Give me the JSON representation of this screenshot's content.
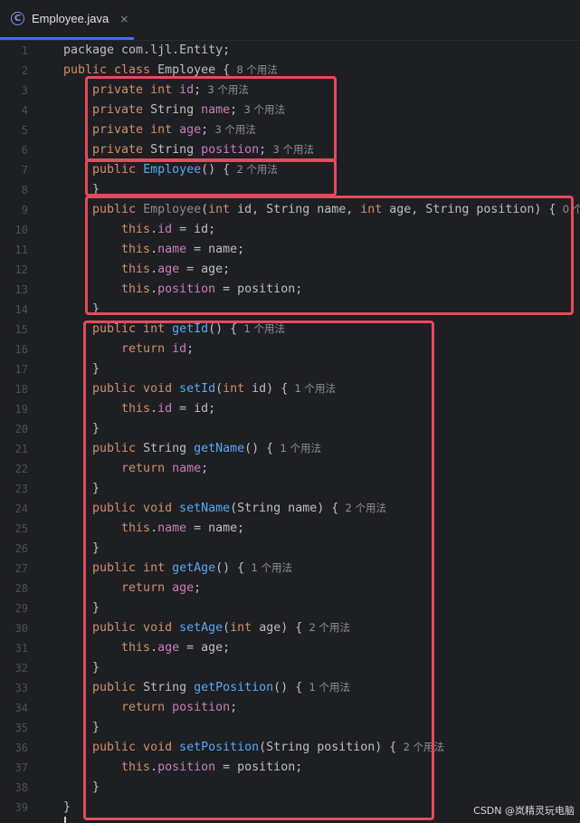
{
  "tab": {
    "icon": "class-icon",
    "icon_glyph": "C",
    "title": "Employee.java",
    "close_glyph": "×"
  },
  "lines": [
    {
      "n": "1",
      "tokens": [
        {
          "t": "package com.ljl.Entity;",
          "c": ""
        }
      ]
    },
    {
      "n": "2",
      "tokens": [
        {
          "t": "public class ",
          "c": "kw"
        },
        {
          "t": "Employee {",
          "c": ""
        },
        {
          "t": "  8 个用法",
          "c": "hint"
        }
      ]
    },
    {
      "n": "3",
      "tokens": [
        {
          "t": "    private int ",
          "c": "kw"
        },
        {
          "t": "id",
          "c": "fld"
        },
        {
          "t": ";",
          "c": ""
        },
        {
          "t": "  3 个用法",
          "c": "hint"
        }
      ]
    },
    {
      "n": "4",
      "tokens": [
        {
          "t": "    private ",
          "c": "kw"
        },
        {
          "t": "String ",
          "c": ""
        },
        {
          "t": "name",
          "c": "fld"
        },
        {
          "t": ";",
          "c": ""
        },
        {
          "t": "  3 个用法",
          "c": "hint"
        }
      ]
    },
    {
      "n": "5",
      "tokens": [
        {
          "t": "    private int ",
          "c": "kw"
        },
        {
          "t": "age",
          "c": "fld"
        },
        {
          "t": ";",
          "c": ""
        },
        {
          "t": "  3 个用法",
          "c": "hint"
        }
      ]
    },
    {
      "n": "6",
      "tokens": [
        {
          "t": "    private ",
          "c": "kw"
        },
        {
          "t": "String ",
          "c": ""
        },
        {
          "t": "position",
          "c": "fld"
        },
        {
          "t": ";",
          "c": ""
        },
        {
          "t": "  3 个用法",
          "c": "hint"
        }
      ]
    },
    {
      "n": "7",
      "tokens": [
        {
          "t": "    public ",
          "c": "kw"
        },
        {
          "t": "Employee",
          "c": "ctor"
        },
        {
          "t": "() {",
          "c": ""
        },
        {
          "t": "  2 个用法",
          "c": "hint"
        }
      ]
    },
    {
      "n": "8",
      "tokens": [
        {
          "t": "    }",
          "c": ""
        }
      ]
    },
    {
      "n": "9",
      "tokens": [
        {
          "t": "    public ",
          "c": "kw"
        },
        {
          "t": "Employee",
          "c": "ctor-unused"
        },
        {
          "t": "(",
          "c": ""
        },
        {
          "t": "int ",
          "c": "kw"
        },
        {
          "t": "id, String name, ",
          "c": ""
        },
        {
          "t": "int ",
          "c": "kw"
        },
        {
          "t": "age, String position) {",
          "c": ""
        },
        {
          "t": "  0 个",
          "c": "hint"
        }
      ]
    },
    {
      "n": "10",
      "tokens": [
        {
          "t": "        this",
          "c": "kw"
        },
        {
          "t": ".",
          "c": ""
        },
        {
          "t": "id",
          "c": "fld"
        },
        {
          "t": " = id;",
          "c": ""
        }
      ]
    },
    {
      "n": "11",
      "tokens": [
        {
          "t": "        this",
          "c": "kw"
        },
        {
          "t": ".",
          "c": ""
        },
        {
          "t": "name",
          "c": "fld"
        },
        {
          "t": " = name;",
          "c": ""
        }
      ]
    },
    {
      "n": "12",
      "tokens": [
        {
          "t": "        this",
          "c": "kw"
        },
        {
          "t": ".",
          "c": ""
        },
        {
          "t": "age",
          "c": "fld"
        },
        {
          "t": " = age;",
          "c": ""
        }
      ]
    },
    {
      "n": "13",
      "tokens": [
        {
          "t": "        this",
          "c": "kw"
        },
        {
          "t": ".",
          "c": ""
        },
        {
          "t": "position",
          "c": "fld"
        },
        {
          "t": " = position;",
          "c": ""
        }
      ]
    },
    {
      "n": "14",
      "tokens": [
        {
          "t": "    }",
          "c": ""
        }
      ]
    },
    {
      "n": "15",
      "tokens": [
        {
          "t": "    public int ",
          "c": "kw"
        },
        {
          "t": "getId",
          "c": "fn"
        },
        {
          "t": "() {",
          "c": ""
        },
        {
          "t": "  1 个用法",
          "c": "hint"
        }
      ]
    },
    {
      "n": "16",
      "tokens": [
        {
          "t": "        return ",
          "c": "kw"
        },
        {
          "t": "id",
          "c": "fld"
        },
        {
          "t": ";",
          "c": ""
        }
      ]
    },
    {
      "n": "17",
      "tokens": [
        {
          "t": "    }",
          "c": ""
        }
      ]
    },
    {
      "n": "18",
      "tokens": [
        {
          "t": "    public void ",
          "c": "kw"
        },
        {
          "t": "setId",
          "c": "fn"
        },
        {
          "t": "(",
          "c": ""
        },
        {
          "t": "int ",
          "c": "kw"
        },
        {
          "t": "id) {",
          "c": ""
        },
        {
          "t": "  1 个用法",
          "c": "hint"
        }
      ]
    },
    {
      "n": "19",
      "tokens": [
        {
          "t": "        this",
          "c": "kw"
        },
        {
          "t": ".",
          "c": ""
        },
        {
          "t": "id",
          "c": "fld"
        },
        {
          "t": " = id;",
          "c": ""
        }
      ]
    },
    {
      "n": "20",
      "tokens": [
        {
          "t": "    }",
          "c": ""
        }
      ]
    },
    {
      "n": "21",
      "tokens": [
        {
          "t": "    public ",
          "c": "kw"
        },
        {
          "t": "String ",
          "c": ""
        },
        {
          "t": "getName",
          "c": "fn"
        },
        {
          "t": "() {",
          "c": ""
        },
        {
          "t": "  1 个用法",
          "c": "hint"
        }
      ]
    },
    {
      "n": "22",
      "tokens": [
        {
          "t": "        return ",
          "c": "kw"
        },
        {
          "t": "name",
          "c": "fld"
        },
        {
          "t": ";",
          "c": ""
        }
      ]
    },
    {
      "n": "23",
      "tokens": [
        {
          "t": "    }",
          "c": ""
        }
      ]
    },
    {
      "n": "24",
      "tokens": [
        {
          "t": "    public void ",
          "c": "kw"
        },
        {
          "t": "setName",
          "c": "fn"
        },
        {
          "t": "(String name) {",
          "c": ""
        },
        {
          "t": "  2 个用法",
          "c": "hint"
        }
      ]
    },
    {
      "n": "25",
      "tokens": [
        {
          "t": "        this",
          "c": "kw"
        },
        {
          "t": ".",
          "c": ""
        },
        {
          "t": "name",
          "c": "fld"
        },
        {
          "t": " = name;",
          "c": ""
        }
      ]
    },
    {
      "n": "26",
      "tokens": [
        {
          "t": "    }",
          "c": ""
        }
      ]
    },
    {
      "n": "27",
      "tokens": [
        {
          "t": "    public int ",
          "c": "kw"
        },
        {
          "t": "getAge",
          "c": "fn"
        },
        {
          "t": "() {",
          "c": ""
        },
        {
          "t": "  1 个用法",
          "c": "hint"
        }
      ]
    },
    {
      "n": "28",
      "tokens": [
        {
          "t": "        return ",
          "c": "kw"
        },
        {
          "t": "age",
          "c": "fld"
        },
        {
          "t": ";",
          "c": ""
        }
      ]
    },
    {
      "n": "29",
      "tokens": [
        {
          "t": "    }",
          "c": ""
        }
      ]
    },
    {
      "n": "30",
      "tokens": [
        {
          "t": "    public void ",
          "c": "kw"
        },
        {
          "t": "setAge",
          "c": "fn"
        },
        {
          "t": "(",
          "c": ""
        },
        {
          "t": "int ",
          "c": "kw"
        },
        {
          "t": "age) {",
          "c": ""
        },
        {
          "t": "  2 个用法",
          "c": "hint"
        }
      ]
    },
    {
      "n": "31",
      "tokens": [
        {
          "t": "        this",
          "c": "kw"
        },
        {
          "t": ".",
          "c": ""
        },
        {
          "t": "age",
          "c": "fld"
        },
        {
          "t": " = age;",
          "c": ""
        }
      ]
    },
    {
      "n": "32",
      "tokens": [
        {
          "t": "    }",
          "c": ""
        }
      ]
    },
    {
      "n": "33",
      "tokens": [
        {
          "t": "    public ",
          "c": "kw"
        },
        {
          "t": "String ",
          "c": ""
        },
        {
          "t": "getPosition",
          "c": "fn"
        },
        {
          "t": "() {",
          "c": ""
        },
        {
          "t": "  1 个用法",
          "c": "hint"
        }
      ]
    },
    {
      "n": "34",
      "tokens": [
        {
          "t": "        return ",
          "c": "kw"
        },
        {
          "t": "position",
          "c": "fld"
        },
        {
          "t": ";",
          "c": ""
        }
      ]
    },
    {
      "n": "35",
      "tokens": [
        {
          "t": "    }",
          "c": ""
        }
      ]
    },
    {
      "n": "36",
      "tokens": [
        {
          "t": "    public void ",
          "c": "kw"
        },
        {
          "t": "setPosition",
          "c": "fn"
        },
        {
          "t": "(String position) {",
          "c": ""
        },
        {
          "t": "  2 个用法",
          "c": "hint"
        }
      ]
    },
    {
      "n": "37",
      "tokens": [
        {
          "t": "        this",
          "c": "kw"
        },
        {
          "t": ".",
          "c": ""
        },
        {
          "t": "position",
          "c": "fld"
        },
        {
          "t": " = position;",
          "c": ""
        }
      ]
    },
    {
      "n": "38",
      "tokens": [
        {
          "t": "    }",
          "c": ""
        }
      ]
    },
    {
      "n": "39",
      "tokens": [
        {
          "t": "}",
          "c": ""
        }
      ]
    }
  ],
  "highlight_color": "#e24c5d",
  "watermark": "CSDN @岚精灵玩电脑"
}
